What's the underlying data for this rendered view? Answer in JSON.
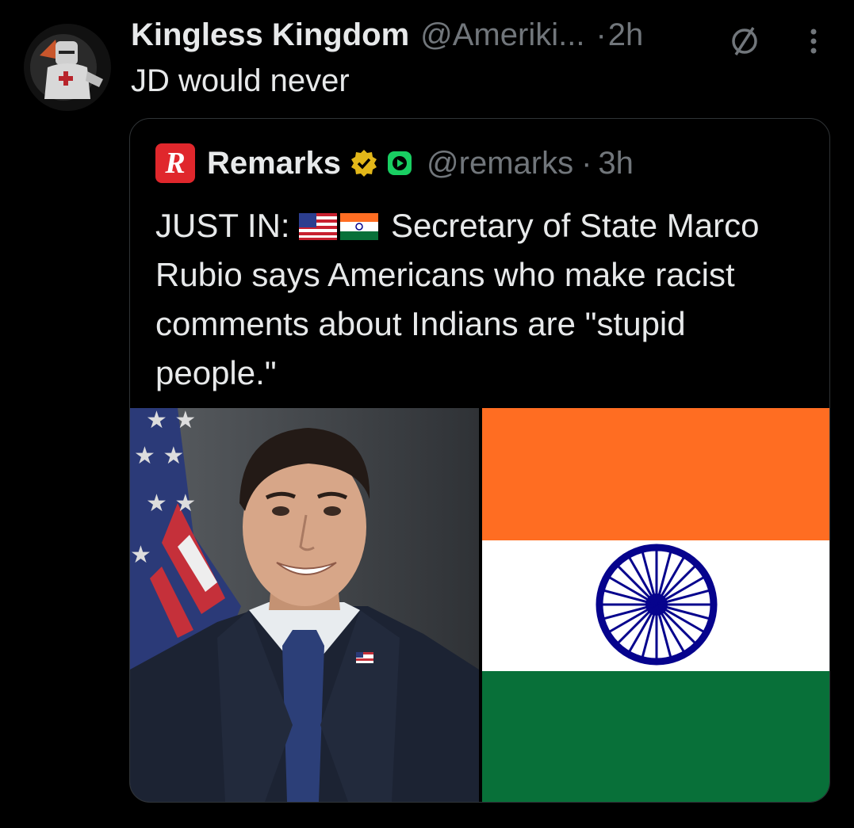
{
  "tweet": {
    "display_name": "Kingless Kingdom",
    "handle": "@Ameriki...",
    "separator": "·",
    "time": "2h",
    "text": "JD would never",
    "avatar_icon": "knight-avatar-icon",
    "more_icon": "more-vertical-icon"
  },
  "quote": {
    "display_name": "Remarks",
    "handle": "@remarks",
    "separator": "·",
    "time": "3h",
    "logo_letter": "R",
    "text_prefix": "JUST IN:",
    "text_body": "Secretary of State Marco Rubio says Americans who make racist comments about Indians are \"stupid people.\"",
    "media": [
      "portrait-photo",
      "india-flag"
    ]
  },
  "colors": {
    "background": "#000000",
    "text": "#e7e9ea",
    "muted": "#71767b",
    "border": "#2f3336",
    "verified_gold": "#e2b719",
    "saffron": "#ff6d22",
    "india_green": "#087039",
    "chakra_navy": "#06038d"
  }
}
